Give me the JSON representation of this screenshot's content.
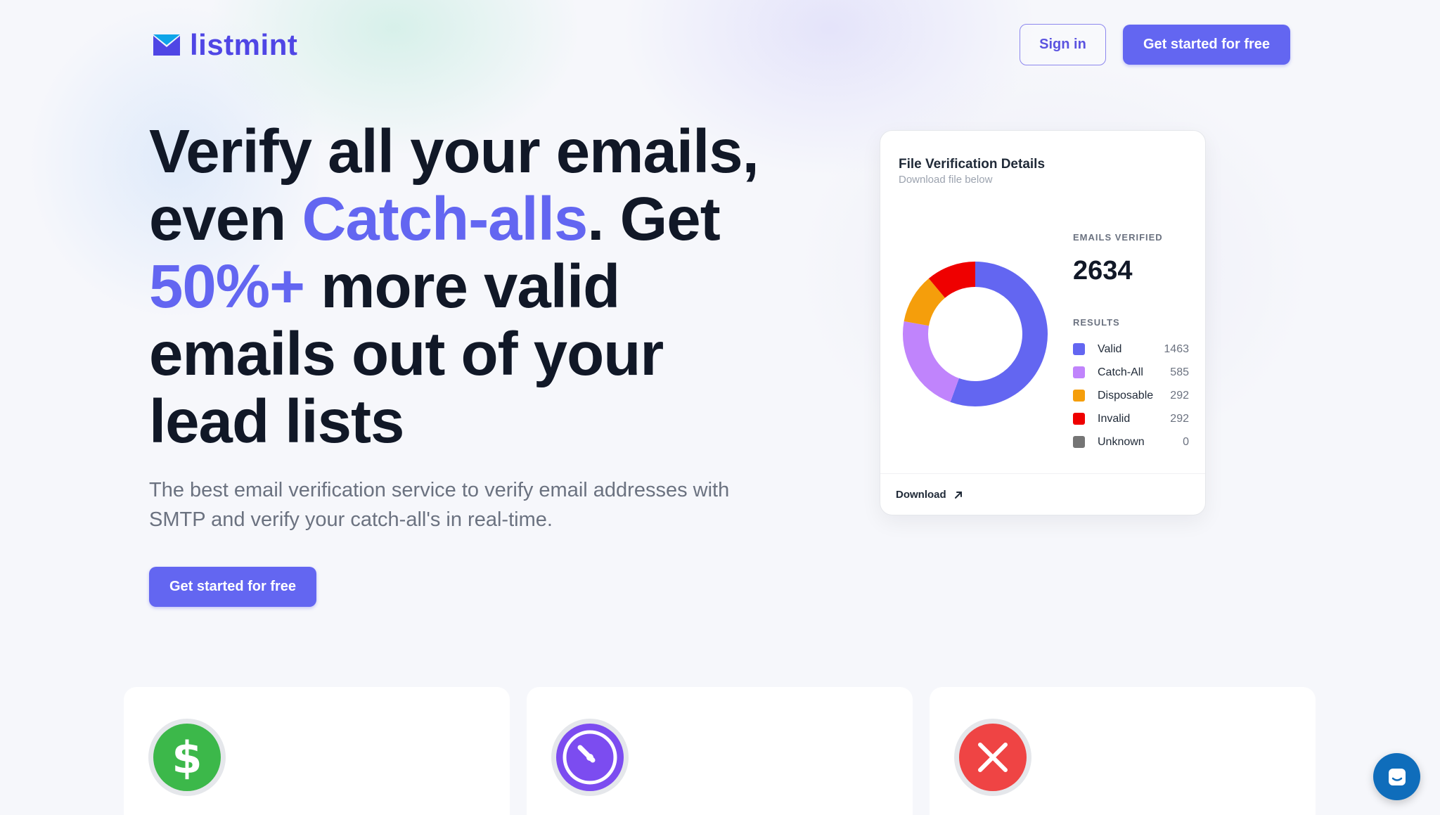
{
  "brand": {
    "name": "listmint",
    "color": "#4f46e5"
  },
  "header": {
    "sign_in": "Sign in",
    "cta": "Get started for free"
  },
  "hero": {
    "title_part1": "Verify all your emails, even ",
    "title_accent1": "Catch-alls",
    "title_part2": ". Get ",
    "title_accent2": " 50%+",
    "title_part3": " more valid emails out of your lead lists",
    "subtitle": "The best email verification service to verify email addresses with SMTP and verify your catch-all's in real-time.",
    "cta": "Get started for free",
    "accent_color": "#6366f1"
  },
  "card": {
    "title": "File Verification Details",
    "subtitle": "Download file below",
    "emails_verified_label": "EMAILS VERIFIED",
    "emails_verified_value": "2634",
    "results_label": "RESULTS",
    "download_label": "Download"
  },
  "chart_data": {
    "type": "pie",
    "categories": [
      "Valid",
      "Catch-All",
      "Disposable",
      "Invalid",
      "Unknown"
    ],
    "values": [
      1463,
      585,
      292,
      292,
      0
    ],
    "colors": [
      "#6366f1",
      "#c084fc",
      "#f59e0b",
      "#ef0000",
      "#757575"
    ]
  },
  "features": [
    {
      "icon": "dollar-icon",
      "color": "#3cb84a"
    },
    {
      "icon": "timer-icon",
      "color": "#7c4cf0"
    },
    {
      "icon": "close-icon",
      "color": "#ef4444"
    }
  ],
  "chat": {
    "icon": "chat-icon",
    "color": "#0f6dbb"
  }
}
